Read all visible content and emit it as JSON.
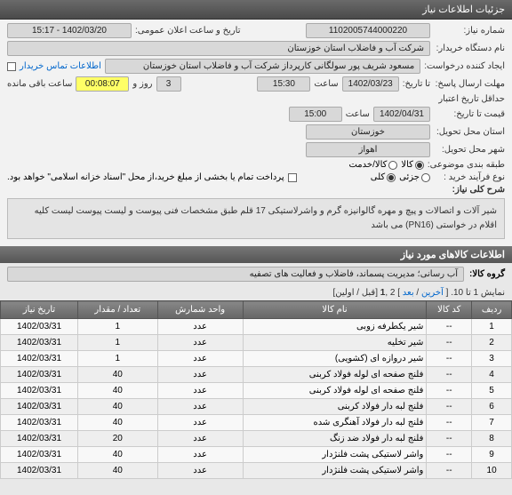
{
  "header": {
    "title": "جزئیات اطلاعات نیاز"
  },
  "form": {
    "need_no_label": "شماره نیاز:",
    "need_no": "1102005744000220",
    "announce_label": "تاریخ و ساعت اعلان عمومی:",
    "announce_date": "1402/03/20 - 15:17",
    "buyer_org_label": "نام دستگاه خریدار:",
    "buyer_org": "شرکت آب و فاضلاب استان خوزستان",
    "creator_label": "ایجاد کننده درخواست:",
    "creator": "مسعود شریف پور سولگانی کارپرداز شرکت آب و فاضلاب استان خوزستان",
    "contact_link": "اطلاعات تماس خریدار",
    "deadline_label": "مهلت ارسال پاسخ:",
    "deadline_until": "تا تاریخ:",
    "deadline_date": "1402/03/23",
    "time_label": "ساعت",
    "deadline_time": "15:30",
    "and_label": "روز و",
    "days_remaining": "3",
    "countdown": "00:08:07",
    "remaining_label": "ساعت باقی مانده",
    "validity_label": "حداقل تاریخ اعتبار",
    "price_until_label": "قیمت تا تاریخ:",
    "validity_date": "1402/04/31",
    "validity_time": "15:00",
    "province_label": "استان محل تحویل:",
    "province": "خوزستان",
    "city_label": "شهر محل تحویل:",
    "city": "اهواز",
    "category_label": "طبقه بندی موضوعی:",
    "cat_goods": "کالا",
    "cat_service": "کالا/خدمت",
    "process_label": "نوع فرآیند خرید :",
    "proc_partial": "جزئی",
    "proc_full": "کلی",
    "note": "پرداخت تمام یا بخشی از مبلغ خرید،از محل \"اسناد خزانه اسلامی\" خواهد بود."
  },
  "summary": {
    "title": "شرح کلی نیاز:",
    "text": "شیر آلات و اتصالات و پیچ و مهره گالوانیزه گرم و واشرلاستیکی 17 قلم طبق مشخصات فنی پیوست  و لیست پیوست لیست کلیه اقلام در خواستی (PN16) می باشد"
  },
  "items_section": {
    "title": "اطلاعات کالاهای مورد نیاز",
    "group_label": "گروه کالا:",
    "group_text": "آب رسانی؛ مدیریت پسماند، فاضلاب و فعالیت های تصفیه"
  },
  "nav": {
    "text_a": "نمایش 1 تا 10. [ ",
    "last": "آخرین",
    "sep1": " / ",
    "next": "بعد",
    "text_b": " ] 2 ,",
    "cur": "1",
    "text_c": " [قبل / اولین]"
  },
  "table": {
    "headers": [
      "ردیف",
      "کد کالا",
      "نام کالا",
      "واحد شمارش",
      "تعداد / مقدار",
      "تاریخ نیاز"
    ],
    "rows": [
      {
        "n": "1",
        "code": "--",
        "name": "شیر یکطرفه زوبی",
        "unit": "عدد",
        "qty": "1",
        "date": "1402/03/31"
      },
      {
        "n": "2",
        "code": "--",
        "name": "شیر تخلیه",
        "unit": "عدد",
        "qty": "1",
        "date": "1402/03/31"
      },
      {
        "n": "3",
        "code": "--",
        "name": "شیر دروازه ای (کشویی)",
        "unit": "عدد",
        "qty": "1",
        "date": "1402/03/31"
      },
      {
        "n": "4",
        "code": "--",
        "name": "فلنج صفحه ای لوله فولاد کربنی",
        "unit": "عدد",
        "qty": "40",
        "date": "1402/03/31"
      },
      {
        "n": "5",
        "code": "--",
        "name": "فلنج صفحه ای لوله فولاد کربنی",
        "unit": "عدد",
        "qty": "40",
        "date": "1402/03/31"
      },
      {
        "n": "6",
        "code": "--",
        "name": "فلنج لبه دار فولاد کربنی",
        "unit": "عدد",
        "qty": "40",
        "date": "1402/03/31"
      },
      {
        "n": "7",
        "code": "--",
        "name": "فلنج لبه دار فولاد آهنگری شده",
        "unit": "عدد",
        "qty": "40",
        "date": "1402/03/31"
      },
      {
        "n": "8",
        "code": "--",
        "name": "فلنج لبه دار فولاد ضد زنگ",
        "unit": "عدد",
        "qty": "20",
        "date": "1402/03/31"
      },
      {
        "n": "9",
        "code": "--",
        "name": "واشر لاستیکی پشت فلنژدار",
        "unit": "عدد",
        "qty": "40",
        "date": "1402/03/31"
      },
      {
        "n": "10",
        "code": "--",
        "name": "واشر لاستیکی پشت فلنژدار",
        "unit": "عدد",
        "qty": "40",
        "date": "1402/03/31"
      }
    ]
  }
}
